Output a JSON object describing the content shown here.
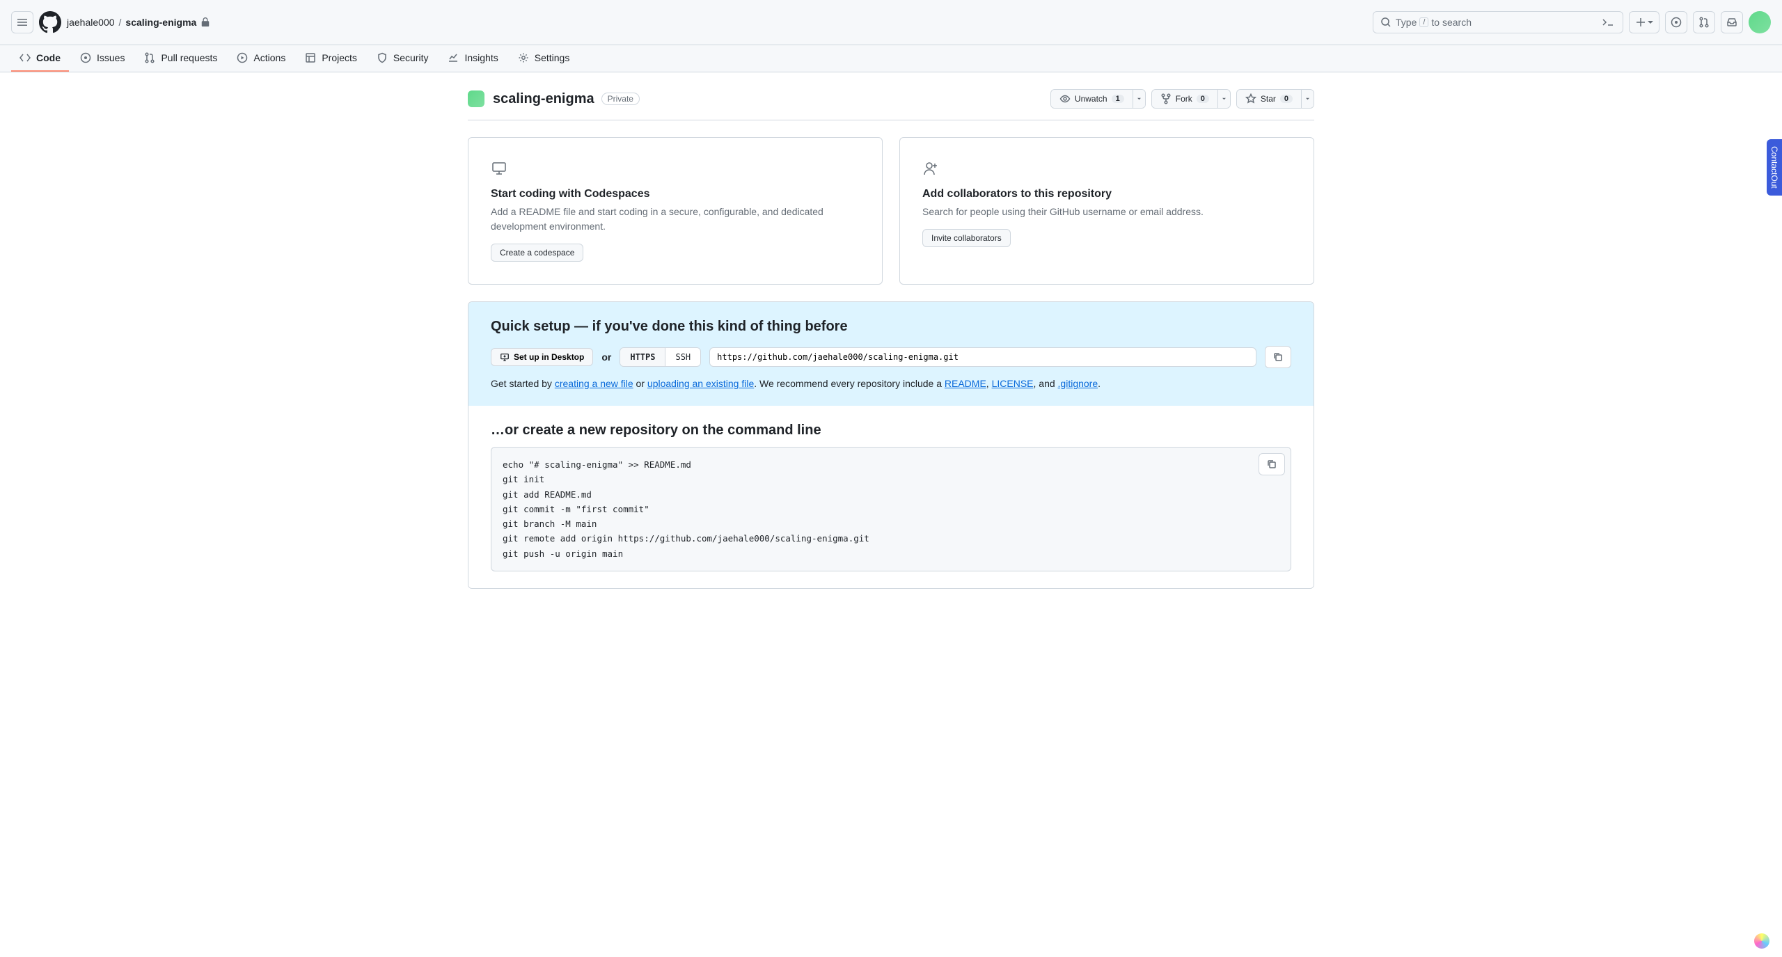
{
  "header": {
    "owner": "jaehale000",
    "sep": "/",
    "repo": "scaling-enigma",
    "search_type": "Type",
    "search_slash": "/",
    "search_to_search": "to search"
  },
  "nav": {
    "code": "Code",
    "issues": "Issues",
    "pulls": "Pull requests",
    "actions": "Actions",
    "projects": "Projects",
    "security": "Security",
    "insights": "Insights",
    "settings": "Settings"
  },
  "repo": {
    "name": "scaling-enigma",
    "visibility": "Private",
    "unwatch": "Unwatch",
    "unwatch_count": "1",
    "fork": "Fork",
    "fork_count": "0",
    "star": "Star",
    "star_count": "0"
  },
  "codespaces": {
    "title": "Start coding with Codespaces",
    "desc": "Add a README file and start coding in a secure, configurable, and dedicated development environment.",
    "button": "Create a codespace"
  },
  "collab": {
    "title": "Add collaborators to this repository",
    "desc": "Search for people using their GitHub username or email address.",
    "button": "Invite collaborators"
  },
  "quick": {
    "title": "Quick setup — if you've done this kind of thing before",
    "desktop": "Set up in Desktop",
    "or": "or",
    "https": "HTTPS",
    "ssh": "SSH",
    "url": "https://github.com/jaehale000/scaling-enigma.git",
    "hint_prefix": "Get started by ",
    "link_create": "creating a new file",
    "hint_or": " or ",
    "link_upload": "uploading an existing file",
    "hint_rec": ". We recommend every repository include a ",
    "link_readme": "README",
    "hint_comma": ", ",
    "link_license": "LICENSE",
    "hint_and": ", and ",
    "link_gitignore": ".gitignore",
    "hint_end": "."
  },
  "cmdline": {
    "title": "…or create a new repository on the command line",
    "code": "echo \"# scaling-enigma\" >> README.md\ngit init\ngit add README.md\ngit commit -m \"first commit\"\ngit branch -M main\ngit remote add origin https://github.com/jaehale000/scaling-enigma.git\ngit push -u origin main"
  },
  "contactout": "ContactOut"
}
